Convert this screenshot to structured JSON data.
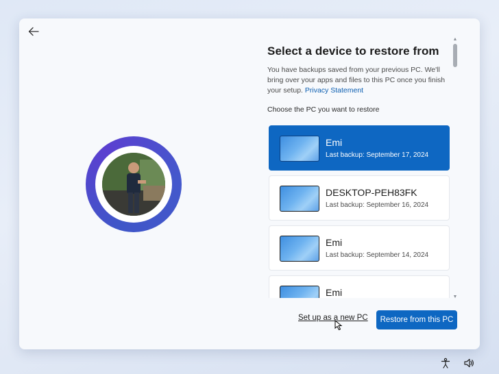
{
  "header": {
    "title": "Select a device to restore from",
    "description": "You have backups saved from your previous PC. We'll bring over your apps and files to this PC once you finish your setup.",
    "privacy_link": "Privacy Statement",
    "choose_label": "Choose the PC you want to restore"
  },
  "devices": [
    {
      "name": "Emi",
      "backup": "Last backup: September 17, 2024",
      "selected": true
    },
    {
      "name": "DESKTOP-PEH83FK",
      "backup": "Last backup: September 16, 2024",
      "selected": false
    },
    {
      "name": "Emi",
      "backup": "Last backup: September 14, 2024",
      "selected": false
    },
    {
      "name": "Emi",
      "backup": "",
      "selected": false
    }
  ],
  "footer": {
    "secondary_label": "Set up as a new PC",
    "primary_label": "Restore from this PC"
  },
  "icons": {
    "back": "arrow-left-icon",
    "accessibility": "accessibility-icon",
    "volume": "volume-icon"
  },
  "colors": {
    "accent": "#0e67c2",
    "avatar_ring": "#4a4fcf"
  }
}
